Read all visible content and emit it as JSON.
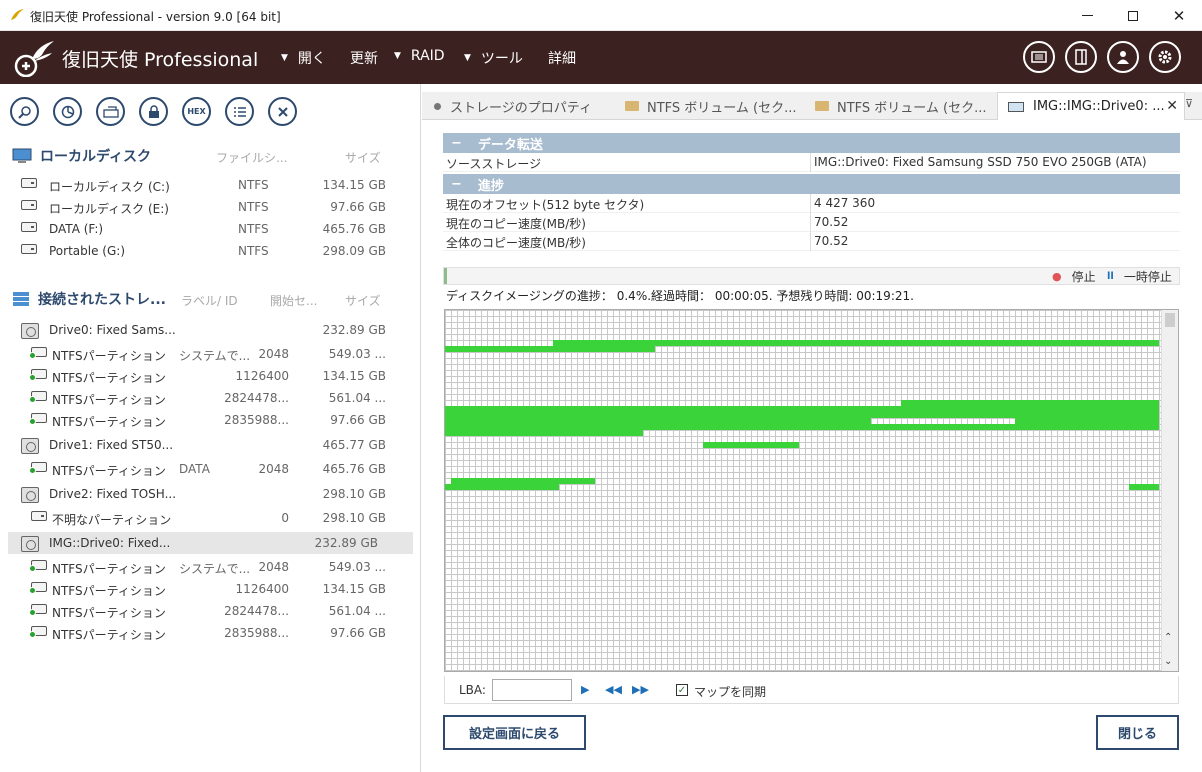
{
  "window": {
    "title": "復旧天使 Professional - version 9.0 [64 bit]"
  },
  "header": {
    "brand": "復旧天使 Professional",
    "menu": [
      {
        "label": "開く",
        "has_arrow": true
      },
      {
        "label": "更新",
        "has_arrow": false
      },
      {
        "label": "RAID",
        "has_arrow": true
      },
      {
        "label": "ツール",
        "has_arrow": true
      },
      {
        "label": "詳細",
        "has_arrow": false
      }
    ],
    "icons": [
      "news-icon",
      "panel-icon",
      "user-icon",
      "settings-icon"
    ]
  },
  "toolbar": {
    "hex_label": "HEX",
    "icons": [
      "search-icon",
      "scan-icon",
      "drive-image-icon",
      "lock-icon",
      "hex-icon",
      "list-icon",
      "close-icon"
    ]
  },
  "local": {
    "title": "ローカルディスク",
    "col_fs": "ファイルシ...",
    "col_size": "サイズ",
    "items": [
      {
        "name": "ローカルディスク (C:)",
        "fs": "NTFS",
        "size": "134.15 GB"
      },
      {
        "name": "ローカルディスク (E:)",
        "fs": "NTFS",
        "size": "97.66 GB"
      },
      {
        "name": "DATA (F:)",
        "fs": "NTFS",
        "size": "465.76 GB"
      },
      {
        "name": "Portable (G:)",
        "fs": "NTFS",
        "size": "298.09 GB"
      }
    ]
  },
  "connected": {
    "title": "接続されたストレ...",
    "col_label": "ラベル/ ID",
    "col_start": "開始セ...",
    "col_size": "サイズ",
    "items": [
      {
        "kind": "drive",
        "name": "Drive0: Fixed Sams...",
        "label": "",
        "start": "",
        "size": "232.89 GB"
      },
      {
        "kind": "part",
        "name": "NTFSパーティション",
        "label": "システムで...",
        "start": "2048",
        "size": "549.03 ..."
      },
      {
        "kind": "part",
        "name": "NTFSパーティション",
        "label": "",
        "start": "1126400",
        "size": "134.15 GB"
      },
      {
        "kind": "part",
        "name": "NTFSパーティション",
        "label": "",
        "start": "2824478...",
        "size": "561.04 ..."
      },
      {
        "kind": "part",
        "name": "NTFSパーティション",
        "label": "",
        "start": "2835988...",
        "size": "97.66 GB"
      },
      {
        "kind": "drive",
        "name": "Drive1: Fixed ST50...",
        "label": "",
        "start": "",
        "size": "465.77 GB"
      },
      {
        "kind": "part",
        "name": "NTFSパーティション",
        "label": "DATA",
        "start": "2048",
        "size": "465.76 GB"
      },
      {
        "kind": "drive",
        "name": "Drive2: Fixed TOSH...",
        "label": "",
        "start": "",
        "size": "298.10 GB"
      },
      {
        "kind": "unknown",
        "name": "不明なパーティション",
        "label": "",
        "start": "0",
        "size": "298.10 GB"
      },
      {
        "kind": "drive",
        "name": "IMG::Drive0: Fixed...",
        "label": "",
        "start": "",
        "size": "232.89 GB",
        "selected": true
      },
      {
        "kind": "part",
        "name": "NTFSパーティション",
        "label": "システムで...",
        "start": "2048",
        "size": "549.03 ..."
      },
      {
        "kind": "part",
        "name": "NTFSパーティション",
        "label": "",
        "start": "1126400",
        "size": "134.15 GB"
      },
      {
        "kind": "part",
        "name": "NTFSパーティション",
        "label": "",
        "start": "2824478...",
        "size": "561.04 ..."
      },
      {
        "kind": "part",
        "name": "NTFSパーティション",
        "label": "",
        "start": "2835988...",
        "size": "97.66 GB"
      }
    ]
  },
  "tabs": [
    {
      "label": "ストレージのプロパティ",
      "icon": "dot"
    },
    {
      "label": "NTFS ボリューム (セク...",
      "icon": "folder"
    },
    {
      "label": "NTFS ボリューム (セク...",
      "icon": "folder"
    },
    {
      "label": "IMG::IMG::Drive0: ...",
      "icon": "drive",
      "active": true
    }
  ],
  "transfer": {
    "title": "データ転送",
    "source_label": "ソースストレージ",
    "source_value": "IMG::Drive0: Fixed Samsung SSD 750 EVO 250GB (ATA)"
  },
  "progress": {
    "title": "進捗",
    "rows": [
      {
        "label": "現在のオフセット(512 byte セクタ)",
        "value": "4 427 360"
      },
      {
        "label": "現在のコピー速度(MB/秒)",
        "value": "70.52"
      },
      {
        "label": "全体のコピー速度(MB/秒)",
        "value": "70.52"
      }
    ],
    "fraction": 0.004,
    "stop_label": "停止",
    "pause_label": "一時停止",
    "status": "ディスクイメージングの進捗： 0.4%.経過時間： 00:00:05. 予想残り時間: 00:19:21."
  },
  "map": {
    "lba_label": "LBA:",
    "lba_value": "",
    "sync_label": "マップを同期",
    "sync_checked": true,
    "fill_color": "#3ad33a"
  },
  "buttons": {
    "back": "設定画面に戻る",
    "close": "閉じる"
  }
}
